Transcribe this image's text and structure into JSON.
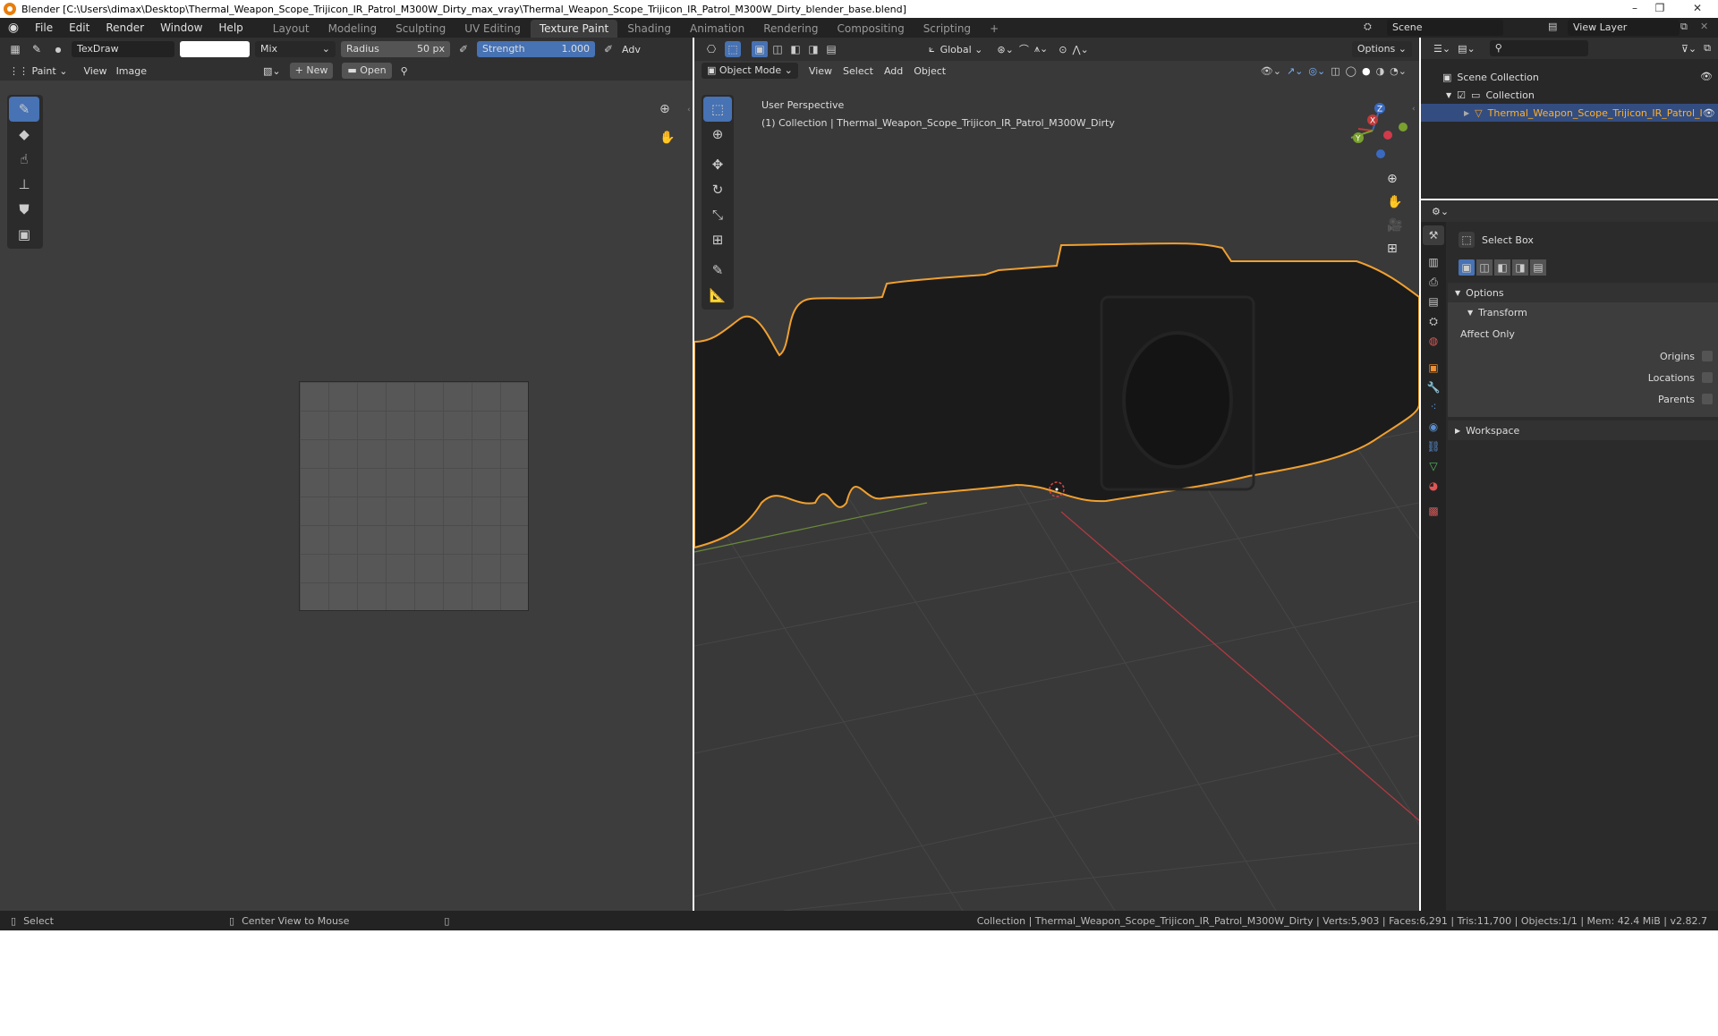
{
  "window": {
    "title": "Blender [C:\\Users\\dimax\\Desktop\\Thermal_Weapon_Scope_Trijicon_IR_Patrol_M300W_Dirty_max_vray\\Thermal_Weapon_Scope_Trijicon_IR_Patrol_M300W_Dirty_blender_base.blend]",
    "min": "–",
    "max": "❐",
    "close": "✕"
  },
  "menu": [
    "File",
    "Edit",
    "Render",
    "Window",
    "Help"
  ],
  "workspaces": [
    "Layout",
    "Modeling",
    "Sculpting",
    "UV Editing",
    "Texture Paint",
    "Shading",
    "Animation",
    "Rendering",
    "Compositing",
    "Scripting",
    "+"
  ],
  "scene": {
    "name": "Scene",
    "view_layer": "View Layer"
  },
  "image_editor": {
    "brush": "TexDraw",
    "blend": "Mix",
    "radius_label": "Radius",
    "radius_value": "50 px",
    "strength_label": "Strength",
    "strength_value": "1.000",
    "adv": "Adv",
    "mode": "Paint",
    "view": "View",
    "image": "Image",
    "new": "New",
    "open": "Open"
  },
  "viewport": {
    "orientation": "Global",
    "options": "Options",
    "mode": "Object Mode",
    "view": "View",
    "select": "Select",
    "add": "Add",
    "object": "Object",
    "perspective": "User Perspective",
    "collection_info": "(1) Collection | Thermal_Weapon_Scope_Trijicon_IR_Patrol_M300W_Dirty",
    "gizmo": {
      "x": "X",
      "y": "Y",
      "z": "Z"
    }
  },
  "outliner": {
    "scene_collection": "Scene Collection",
    "collection": "Collection",
    "object": "Thermal_Weapon_Scope_Trijicon_IR_Patrol_I"
  },
  "properties": {
    "tool": "Select Box",
    "options": "Options",
    "transform": "Transform",
    "affect_only": "Affect Only",
    "origins": "Origins",
    "locations": "Locations",
    "parents": "Parents",
    "workspace": "Workspace"
  },
  "statusbar": {
    "select": "Select",
    "center": "Center View to Mouse",
    "info": "Collection | Thermal_Weapon_Scope_Trijicon_IR_Patrol_M300W_Dirty | Verts:5,903 | Faces:6,291 | Tris:11,700 | Objects:1/1 | Mem: 42.4 MiB | v2.82.7"
  },
  "colors": {
    "accent": "#4772b3",
    "selection": "#ffa030",
    "bg": "#303030"
  }
}
